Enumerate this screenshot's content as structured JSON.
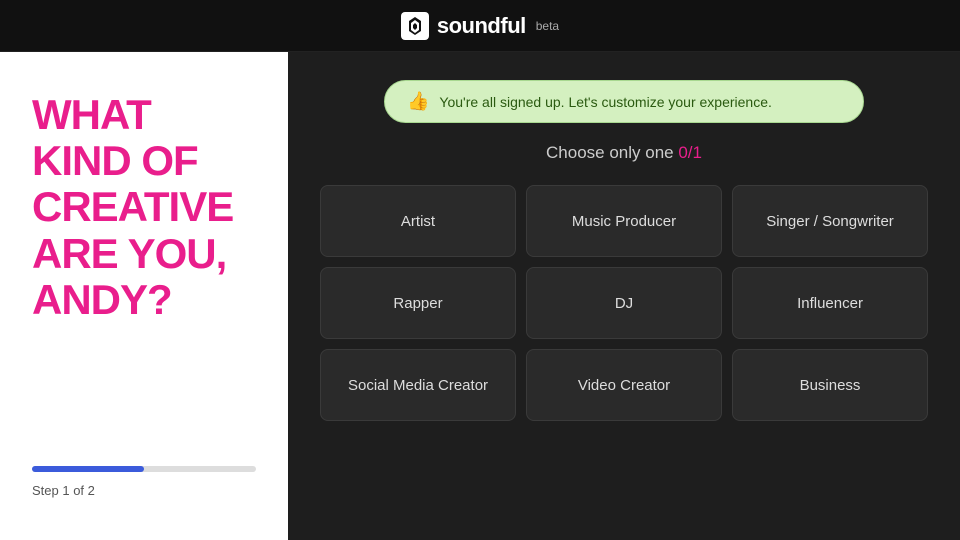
{
  "header": {
    "logo_text": "soundful",
    "beta_label": "beta"
  },
  "left_panel": {
    "title": "WHAT KIND OF CREATIVE ARE YOU, ANDY?",
    "step_label": "Step 1 of 2",
    "progress_percent": 50
  },
  "right_panel": {
    "notification": {
      "icon": "👍",
      "text": "You're all signed up. Let's customize your experience."
    },
    "choose_label": "Choose only one",
    "count": "0/1",
    "options": [
      {
        "id": "artist",
        "label": "Artist"
      },
      {
        "id": "music-producer",
        "label": "Music Producer"
      },
      {
        "id": "singer-songwriter",
        "label": "Singer / Songwriter"
      },
      {
        "id": "rapper",
        "label": "Rapper"
      },
      {
        "id": "dj",
        "label": "DJ"
      },
      {
        "id": "influencer",
        "label": "Influencer"
      },
      {
        "id": "social-media-creator",
        "label": "Social Media Creator"
      },
      {
        "id": "video-creator",
        "label": "Video Creator"
      },
      {
        "id": "business",
        "label": "Business"
      }
    ]
  }
}
